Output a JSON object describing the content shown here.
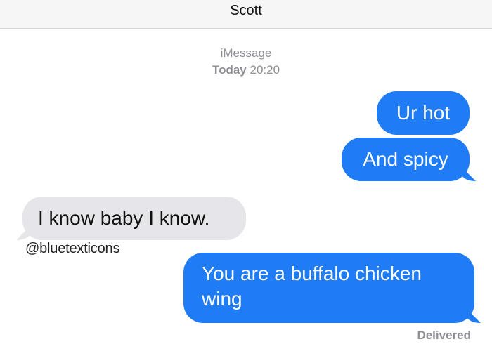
{
  "header": {
    "contact_name": "Scott"
  },
  "conversation": {
    "service": "iMessage",
    "date_label": "Today",
    "time": "20:20",
    "messages": [
      {
        "direction": "sent",
        "text": "Ur hot"
      },
      {
        "direction": "sent",
        "text": "And spicy"
      },
      {
        "direction": "received",
        "text": "I know baby I know."
      },
      {
        "direction": "sent",
        "text": "You are a buffalo chicken wing"
      }
    ],
    "delivery_status": "Delivered"
  },
  "watermark": "@bluetexticons",
  "colors": {
    "sent_bubble": "#1f7cf5",
    "received_bubble": "#e5e5ea",
    "header_background": "#f6f6f7",
    "meta_text": "#8e8e93"
  }
}
